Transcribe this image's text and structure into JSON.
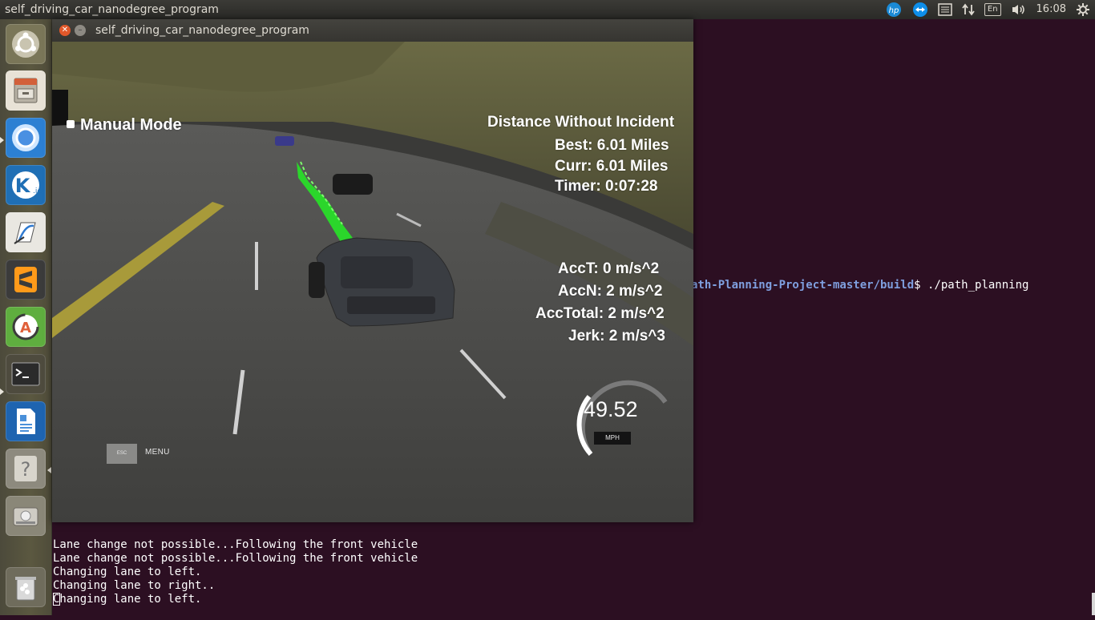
{
  "top_panel": {
    "app_title": "self_driving_car_nanodegree_program",
    "clock": "16:08",
    "language": "En",
    "tray_icons": [
      "hp-icon",
      "teamviewer-icon",
      "menu-list-icon",
      "network-arrows-icon",
      "keyboard-layout-icon",
      "volume-icon",
      "settings-gear-icon"
    ]
  },
  "launcher": {
    "items": [
      {
        "name": "ubuntu-dash",
        "icon": "ubuntu-logo-icon"
      },
      {
        "name": "files",
        "icon": "file-cabinet-icon"
      },
      {
        "name": "chromium",
        "icon": "chromium-icon"
      },
      {
        "name": "komodo-edit",
        "icon": "k-ide-icon"
      },
      {
        "name": "texstudio",
        "icon": "pen-paper-icon"
      },
      {
        "name": "sublime-text",
        "icon": "sublime-icon"
      },
      {
        "name": "software-updater",
        "icon": "updater-icon"
      },
      {
        "name": "terminal",
        "icon": "terminal-icon"
      },
      {
        "name": "libreoffice-writer",
        "icon": "writer-document-icon"
      },
      {
        "name": "help",
        "icon": "question-icon"
      },
      {
        "name": "disk",
        "icon": "hard-drive-icon"
      },
      {
        "name": "trash",
        "icon": "trash-icon"
      }
    ]
  },
  "simulator": {
    "window_title": "self_driving_car_nanodegree_program",
    "mode": "Manual Mode",
    "distance_header": "Distance Without Incident",
    "best": "Best: 6.01 Miles",
    "curr": "Curr: 6.01 Miles",
    "timer": "Timer: 0:07:28",
    "acc_t": "AccT: 0 m/s^2",
    "acc_n": "AccN: 2 m/s^2",
    "acc_total": "AccTotal: 2 m/s^2",
    "jerk": "Jerk: 2 m/s^3",
    "speed": "49.52",
    "speed_unit": "MPH",
    "esc_label": "ESC",
    "menu_label": "MENU"
  },
  "terminal": {
    "prompt_path": "ath-Planning-Project-master/build",
    "prompt_rest": "$ ./path_planning",
    "lines": [
      "Lane change not possible...Following the front vehicle",
      "Lane change not possible...Following the front vehicle",
      "Changing lane to left.",
      "Changing lane to right..",
      "Changing lane to left."
    ]
  }
}
